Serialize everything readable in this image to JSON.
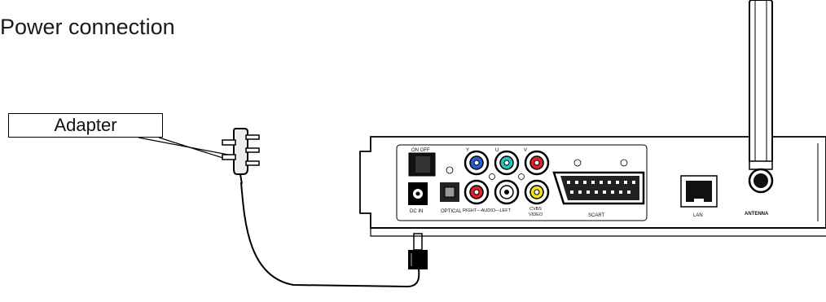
{
  "title": "Power connection",
  "callout": {
    "adapter": "Adapter"
  },
  "panel_labels": {
    "on_off": "ON  OFF",
    "dc_in": "DC IN",
    "optical": "OPTICAL",
    "audio": "RIGHT—AUDIO—LEFT",
    "cvbs": "CVBS",
    "video": "VIDEO",
    "scart": "SCART",
    "lan": "LAN",
    "antenna": "ANTENNA",
    "y": "Y",
    "u": "U",
    "v": "V"
  },
  "jack_colors": {
    "y_blue": "#2a5bd7",
    "u_cyan": "#1ec6c6",
    "v_red": "#e0202a",
    "right_red": "#e0202a",
    "left_white": "#ffffff",
    "cvbs_yellow": "#f2e018"
  }
}
